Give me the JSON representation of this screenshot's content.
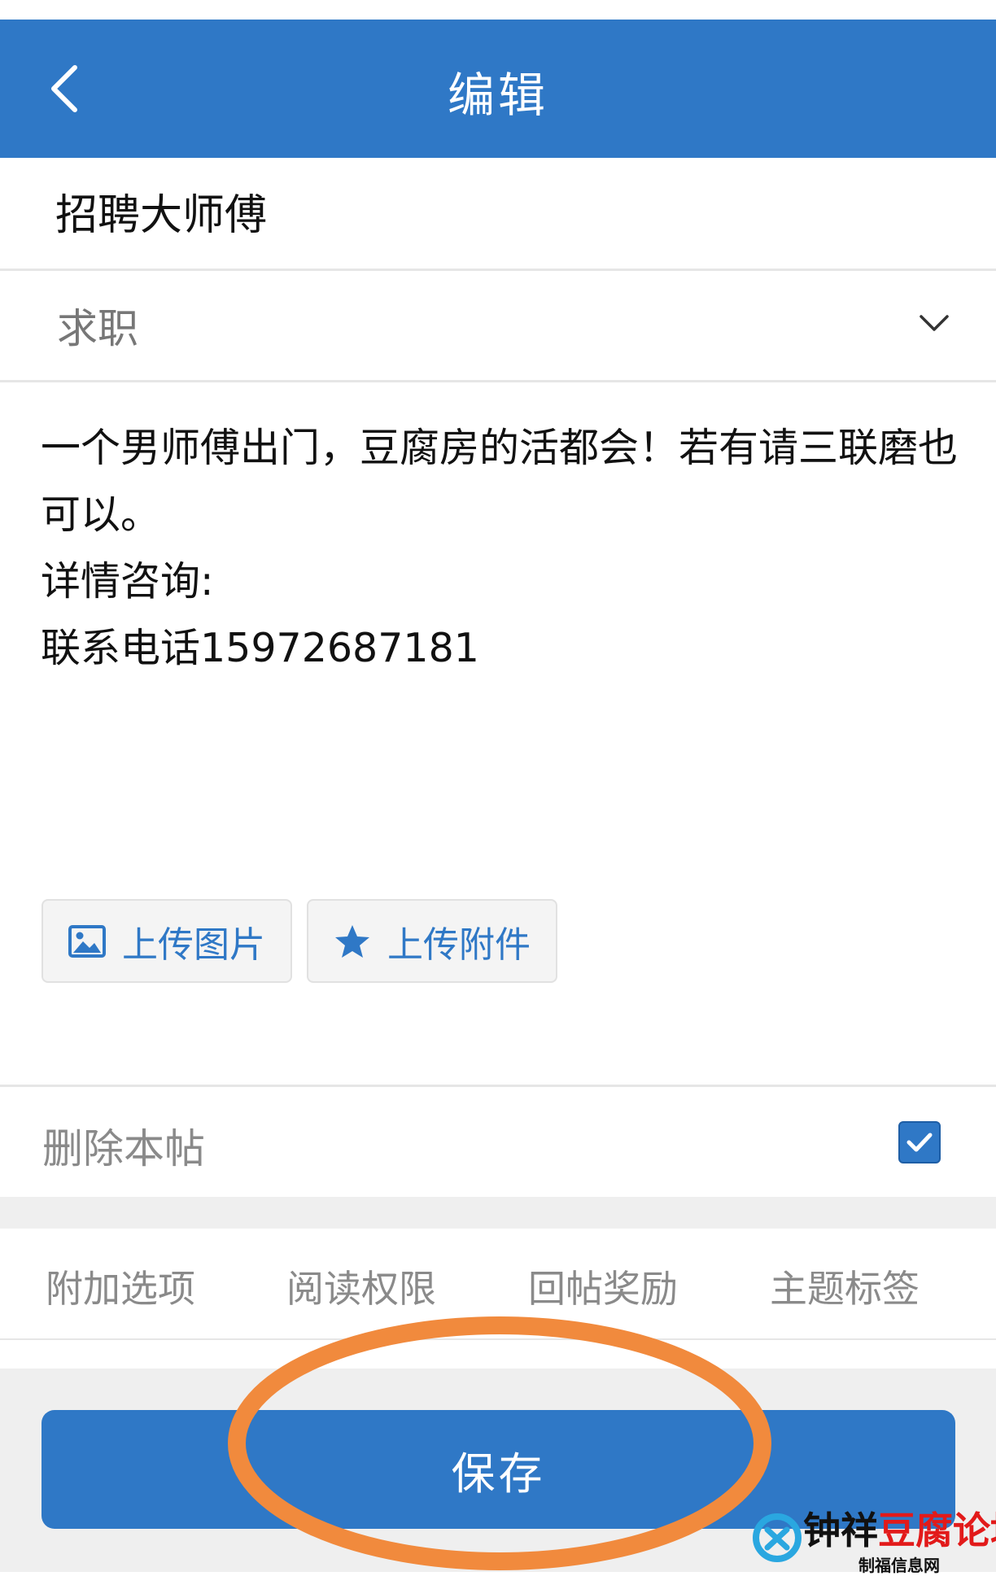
{
  "header": {
    "title": "编辑",
    "back_icon": "chevron-left-icon"
  },
  "form": {
    "title_value": "招聘大师傅",
    "category_value": "求职",
    "content_value": "一个男师傅出门，豆腐房的活都会！若有请三联磨也可以。\n详情咨询:\n联系电话15972687181",
    "upload_image_label": "上传图片",
    "upload_attachment_label": "上传附件",
    "delete_post_label": "删除本帖",
    "delete_post_checked": true
  },
  "tabs": [
    "附加选项",
    "阅读权限",
    "回帖奖励",
    "主题标签"
  ],
  "save_label": "保存",
  "watermark": {
    "main": "钟祥豆腐论坛",
    "sub": "制福信息网"
  },
  "colors": {
    "primary": "#2f78c6",
    "annotation": "#f18a3d"
  }
}
